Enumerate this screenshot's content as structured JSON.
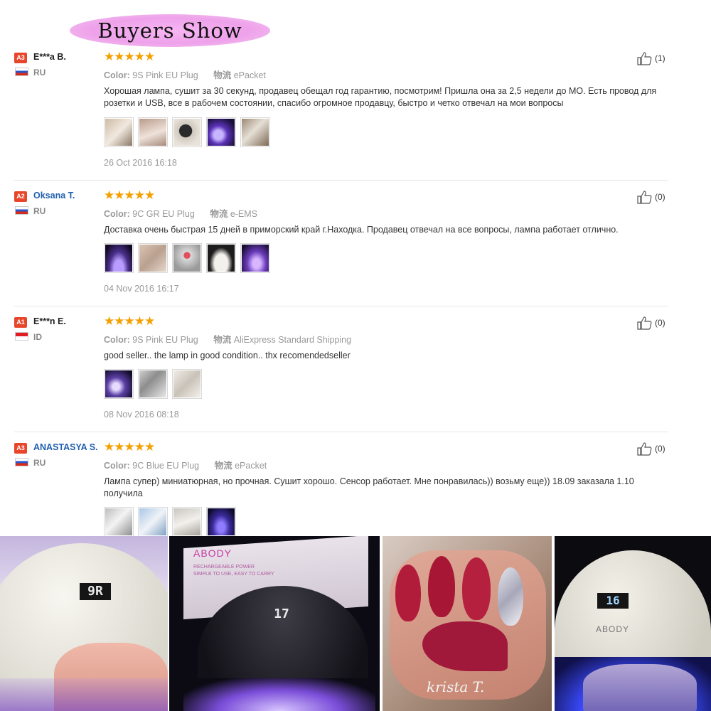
{
  "banner": {
    "title": "Buyers Show"
  },
  "reviews": [
    {
      "level": "A3",
      "name": "E***a B.",
      "country": "RU",
      "stars": "★★★★★",
      "color_label": "Color:",
      "color_value": "9S Pink EU Plug",
      "ship_label": "物流",
      "ship_value": "ePacket",
      "text": "Хорошая лампа, сушит за 30 секунд, продавец обещал год гарантию, посмотрим! Пришла она за 2,5 недели до МО. Есть провод для розетки и USB, все в рабочем состоянии, спасибо огромное продавцу, быстро и четко отвечал на мои вопросы",
      "date": "26 Oct 2016 16:18",
      "likes": "(1)"
    },
    {
      "level": "A2",
      "name": "Oksana T.",
      "country": "RU",
      "stars": "★★★★★",
      "color_label": "Color:",
      "color_value": "9C GR EU Plug",
      "ship_label": "物流",
      "ship_value": "e-EMS",
      "text": "Доставка очень быстрая 15 дней в приморский край г.Находка. Продавец отвечал на все вопросы, лампа работает отлично.",
      "date": "04 Nov 2016 16:17",
      "likes": "(0)"
    },
    {
      "level": "A1",
      "name": "E***n E.",
      "country": "ID",
      "stars": "★★★★★",
      "color_label": "Color:",
      "color_value": "9S Pink EU Plug",
      "ship_label": "物流",
      "ship_value": "AliExpress Standard Shipping",
      "text": "good seller.. the lamp in good condition.. thx recomendedseller",
      "date": "08 Nov 2016 08:18",
      "likes": "(0)"
    },
    {
      "level": "A3",
      "name": "ANASTASYA S.",
      "country": "RU",
      "stars": "★★★★★",
      "color_label": "Color:",
      "color_value": "9C Blue EU Plug",
      "ship_label": "物流",
      "ship_value": "ePacket",
      "text": "Лампа супер) миниатюрная, но прочная. Сушит хорошо. Сенсор работает. Мне понравилась)) возьму еще)) 18.09 заказала 1.10 получила",
      "date": "",
      "likes": "(0)"
    }
  ],
  "photos": {
    "p1_display": "9R",
    "p2_brand": "ABODY",
    "p2_tag1": "RECHARGEABLE POWER",
    "p2_tag2": "SIMPLE TO USE, EASY TO CARRY",
    "p2_display": "17",
    "p3_signature": "krista T.",
    "p4_display": "16",
    "p4_brand": "ABODY"
  },
  "colors": {
    "star": "#f4a000",
    "level_badge": "#e8462a",
    "name_link": "#1f5fb0",
    "banner": "#eea1ea"
  },
  "icons": [
    "thumbs-up-icon",
    "flag-ru-icon",
    "flag-id-icon"
  ]
}
